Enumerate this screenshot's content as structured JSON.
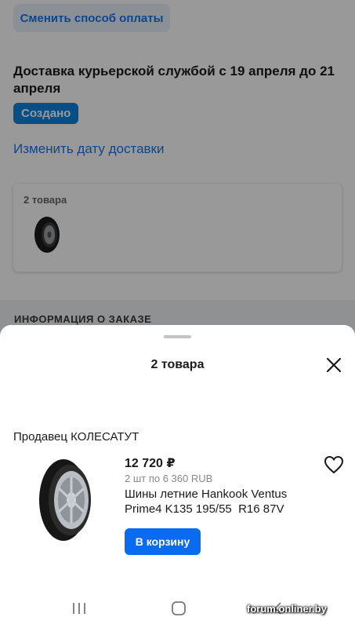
{
  "background": {
    "change_payment_label": "Сменить способ оплаты",
    "delivery_title": "Доставка курьерской службой с 19 апреля до 21 апреля",
    "status_badge": "Создано",
    "change_date_link": "Изменить дату доставки",
    "items_card": {
      "count_label": "2 товара",
      "thumbnail_icon": "tire-icon"
    },
    "info_section_label": "ИНФОРМАЦИЯ О ЗАКАЗЕ"
  },
  "sheet": {
    "title": "2 товара",
    "close_icon": "close-icon",
    "seller_label": "Продавец КОЛЕСАТУТ",
    "product": {
      "price": "12 720 ₽",
      "quantity": "2 шт по 6 360 RUB",
      "name": "Шины летние Hankook Ventus Prime4 K135 195/55  R16 87V",
      "cart_button_label": "В корзину",
      "favorite_icon": "heart-icon"
    }
  },
  "navbar": {
    "items": [
      "recent-apps-icon",
      "home-icon",
      "back-icon"
    ]
  },
  "watermark": "forum.onliner.by",
  "colors": {
    "accent": "#1a74e8",
    "badge": "#0a84e0",
    "cart_button": "#0a6bf0",
    "overlay": "rgba(0,0,0,0.40)"
  }
}
